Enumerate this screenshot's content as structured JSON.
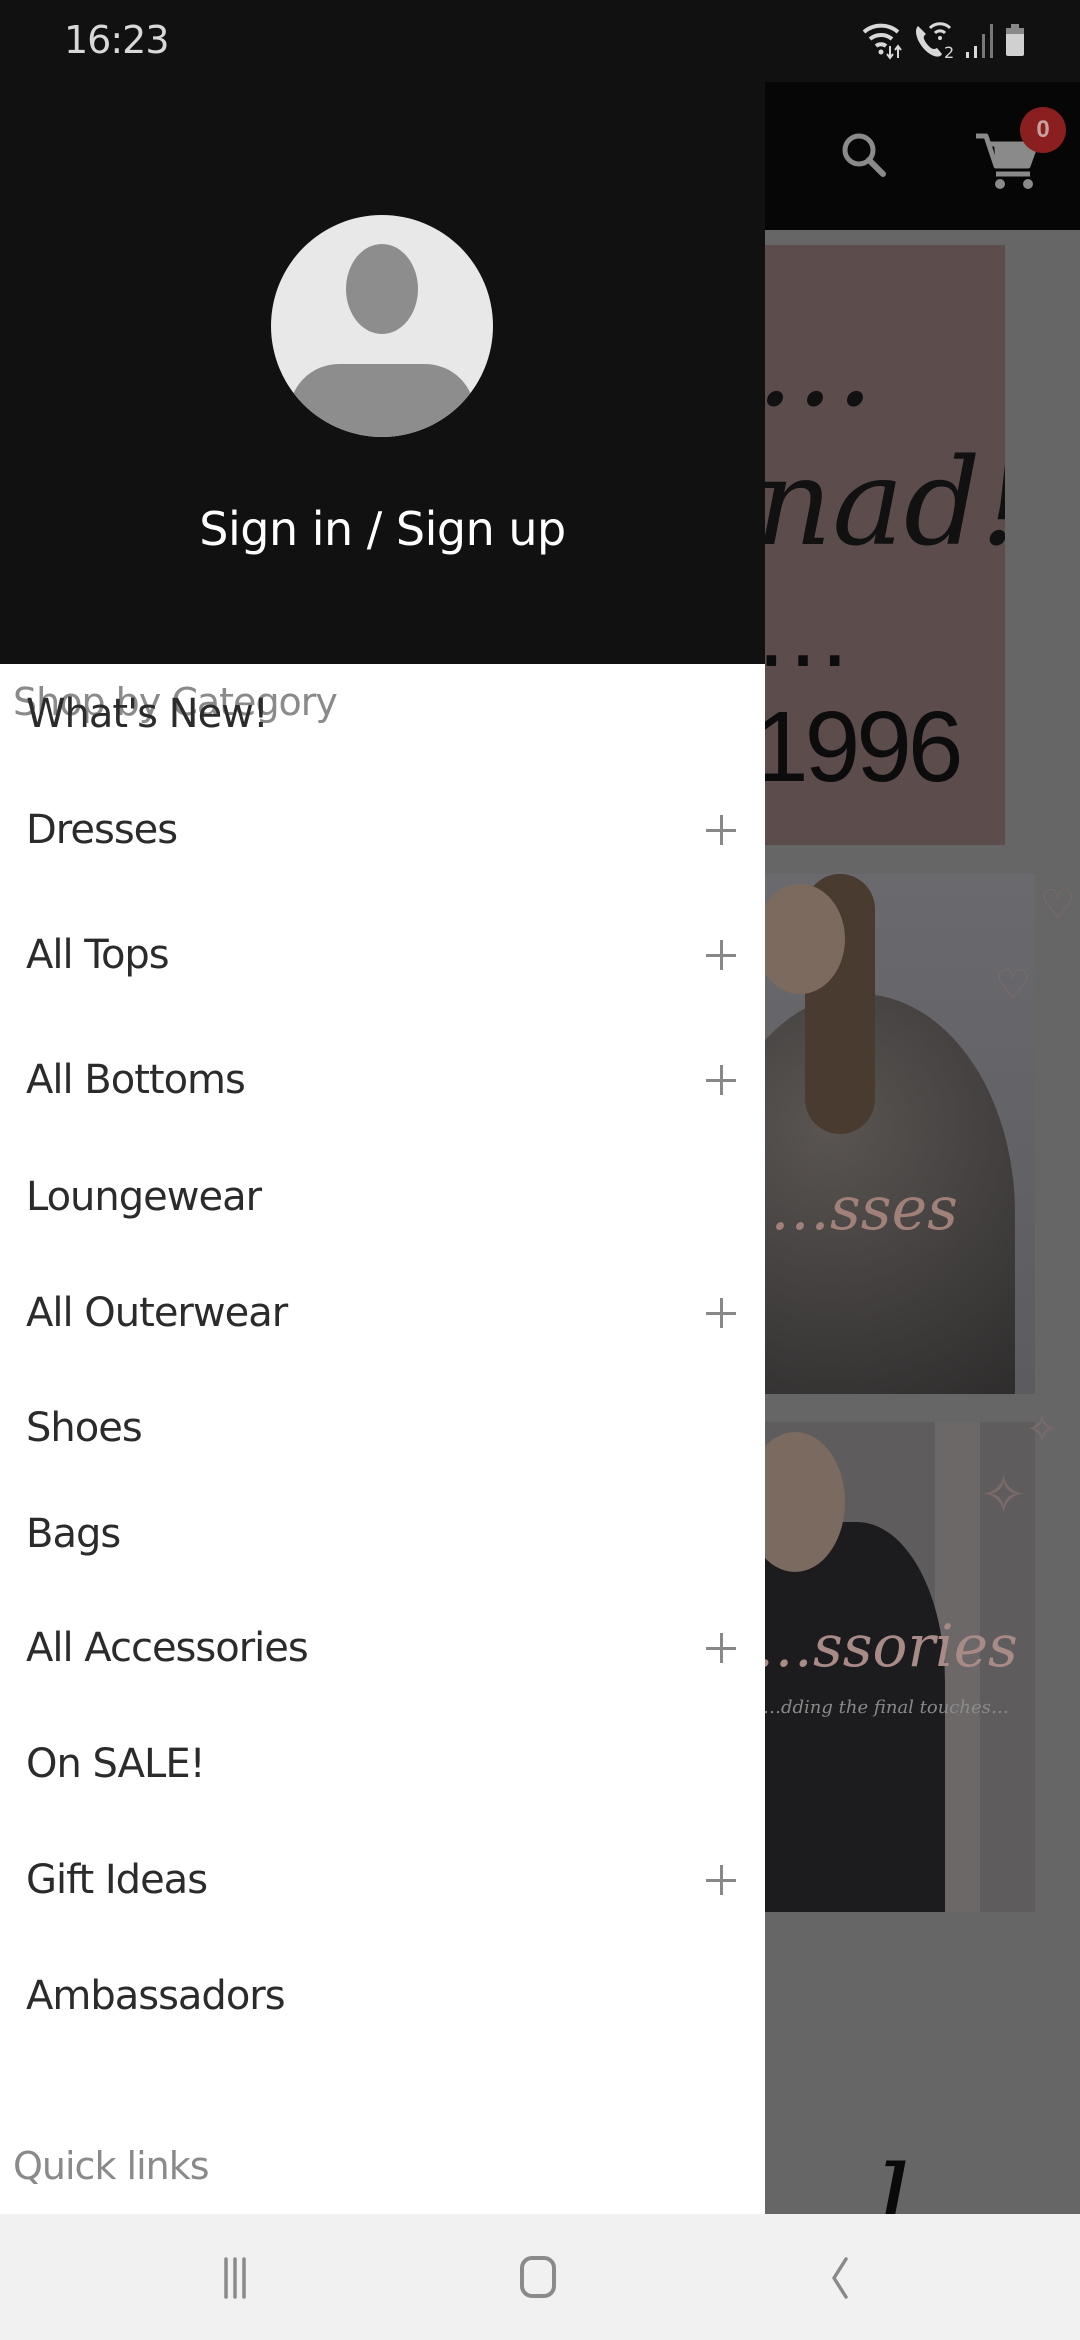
{
  "status_bar": {
    "time": "16:23",
    "icons": [
      "wifi-data-icon",
      "wifi-calling-icon",
      "signal-icon",
      "battery-icon"
    ],
    "wifi_calling_sim": "2"
  },
  "background_page": {
    "header": {
      "icons": [
        "search-icon",
        "cart-icon"
      ],
      "cart_count": "0",
      "cart_badge_color": "#8b1e1e"
    },
    "banners": [
      {
        "script_text": "…nad!",
        "text": "…1996"
      },
      {
        "script_text": "…sses"
      },
      {
        "script_text": "…ssories",
        "subtext": "…dding the final touches…"
      }
    ],
    "bottom_script_text": "…l…"
  },
  "drawer": {
    "sign_in_label": "Sign in / Sign up",
    "shop_by_category_label": "Shop by Category",
    "categories": [
      {
        "label": "What's New!",
        "expandable": false
      },
      {
        "label": "Dresses",
        "expandable": true
      },
      {
        "label": "All Tops",
        "expandable": true
      },
      {
        "label": "All Bottoms",
        "expandable": true
      },
      {
        "label": "Loungewear",
        "expandable": false
      },
      {
        "label": "All Outerwear",
        "expandable": true
      },
      {
        "label": "Shoes",
        "expandable": false
      },
      {
        "label": "Bags",
        "expandable": false
      },
      {
        "label": "All Accessories",
        "expandable": true
      },
      {
        "label": "On SALE!",
        "expandable": false
      },
      {
        "label": "Gift Ideas",
        "expandable": true
      },
      {
        "label": "Ambassadors",
        "expandable": false
      }
    ],
    "quick_links_label": "Quick links"
  },
  "nav_bar": {
    "buttons": [
      "recent-apps",
      "home",
      "back"
    ]
  }
}
